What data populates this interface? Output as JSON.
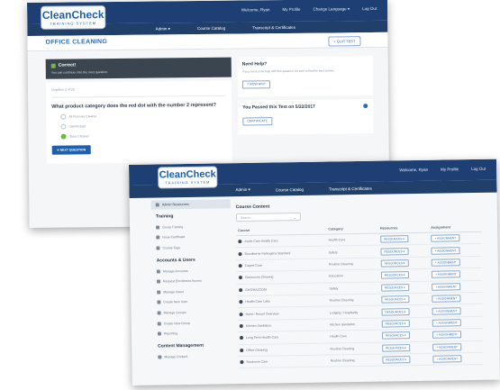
{
  "brand": {
    "name": "CleanCheck",
    "tagline": "TRAINING SYSTEM"
  },
  "colors": {
    "header": "#1e3f73",
    "accent": "#2b6cb6",
    "success": "#6dbb3e",
    "primary_button": "#1e5fae"
  },
  "screen1": {
    "top_links": [
      "Welcome, Ryan",
      "My Profile",
      "Change Language ▾",
      "Log Out"
    ],
    "nav": [
      "Admin ▾",
      "Course Catalog",
      "Transcript & Certificates"
    ],
    "page_title": "OFFICE CLEANING",
    "quit_label": "× QUIT TEST",
    "alert": {
      "title": "Correct!",
      "text": "You can continue onto the next question."
    },
    "question_number": "Question 2 of 20",
    "question_text": "What product category does the red dot with the number 2 represent?",
    "options": [
      "All Purpose Cleaner",
      "Disinfectant",
      "Glass Cleaner"
    ],
    "next_label": "➜ NEXT QUESTION",
    "help": {
      "title": "Need Help?",
      "text": "If you need some help with this question, be sure to find the best answer.",
      "button": "? VIEW HINT"
    },
    "passed": {
      "title": "You Passed this Test on 5/22/2017",
      "button": "CERTIFICATE"
    }
  },
  "screen2": {
    "top_links": [
      "Welcome, Ryan",
      "My Profile",
      "Log Out"
    ],
    "nav": [
      "Admin ▾",
      "Course Catalog",
      "Transcript & Certificates"
    ],
    "sidebar": {
      "active": "Admin Resources",
      "sections": [
        {
          "title": "Training",
          "items": [
            "Group Training",
            "Issue Certificate",
            "Course Tags"
          ]
        },
        {
          "title": "Accounts & Users",
          "items": [
            "Manage Accounts",
            "Request Enrollment Access",
            "Manage Users",
            "Create New User",
            "Manage Groups",
            "Create New Group",
            "Reporting"
          ]
        },
        {
          "title": "Content Management",
          "items": [
            "Manage Content"
          ]
        }
      ]
    },
    "content_title": "Course Content",
    "search_placeholder": "Search...",
    "table": {
      "headers": [
        "Course",
        "Category",
        "Resources",
        "Assignment"
      ],
      "resource_label": "RESOURCES ▾",
      "assign_label": "+ ASSIGNMENT",
      "rows": [
        [
          "Acute Care Health Care",
          "Health Care"
        ],
        [
          "Bloodborne Pathogens Standard",
          "Safety"
        ],
        [
          "Carpet Care",
          "Routine Cleaning"
        ],
        [
          "Classroom Cleaning",
          "Education"
        ],
        [
          "GHS/HAZCOM",
          "Safety"
        ],
        [
          "Health Care Labs",
          "Routine Cleaning"
        ],
        [
          "Hotel / Resort Overview",
          "Lodging / Hospitality"
        ],
        [
          "Kitchen Sanitation",
          "Kitchen Sanitation"
        ],
        [
          "Long Term Health Care",
          "Health Care"
        ],
        [
          "Office Cleaning",
          "Routine Cleaning"
        ],
        [
          "Restroom Care",
          "Routine Cleaning"
        ]
      ]
    }
  }
}
